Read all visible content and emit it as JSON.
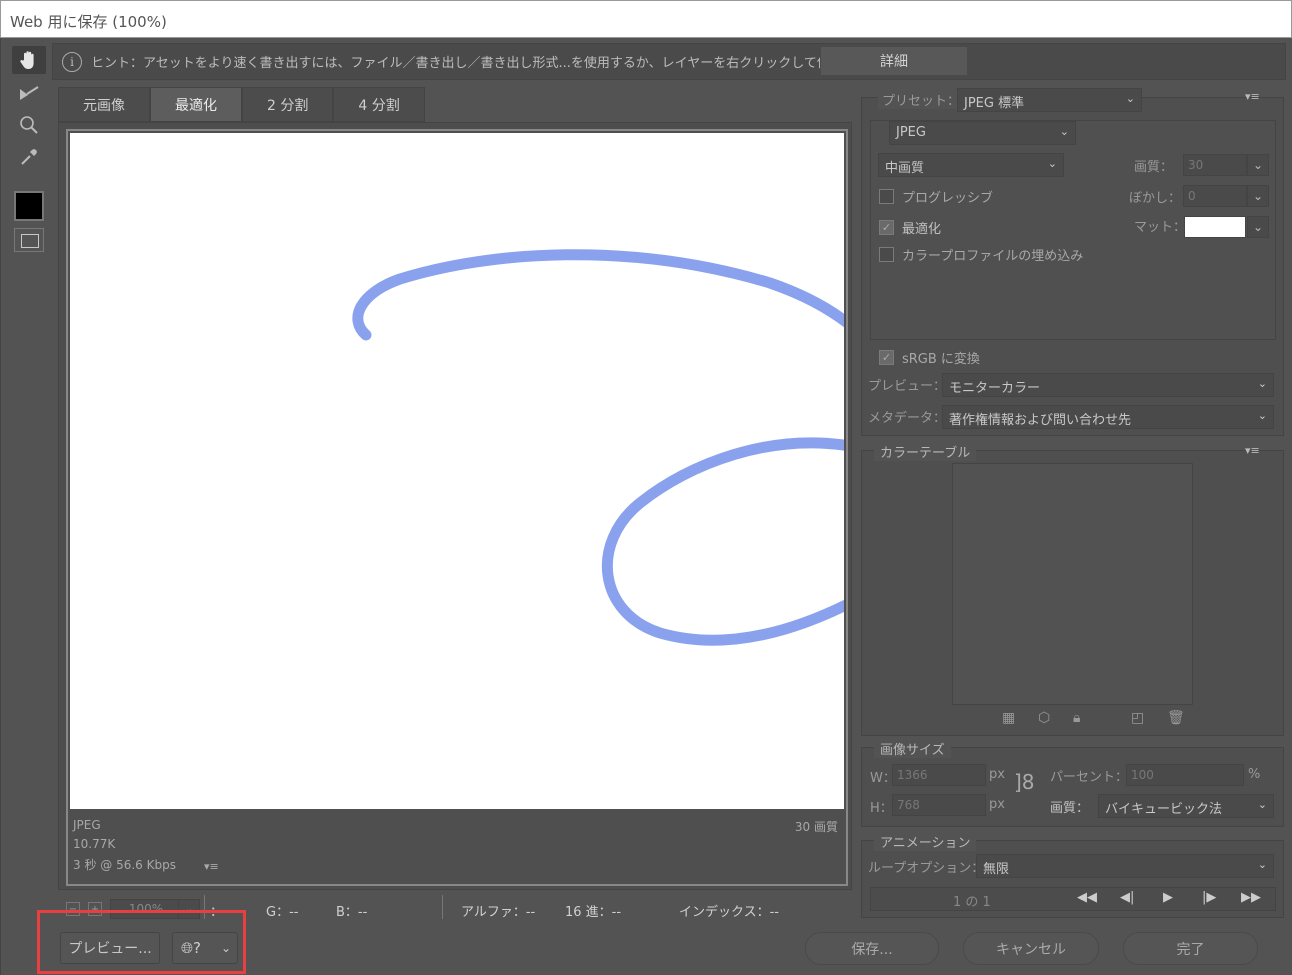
{
  "window": {
    "title": "Web 用に保存 (100%)"
  },
  "tools": [
    {
      "name": "hand-tool-icon",
      "glyph": "✋"
    },
    {
      "name": "slice-select-tool-icon",
      "glyph": "➶"
    },
    {
      "name": "zoom-tool-icon",
      "glyph": "⌕"
    },
    {
      "name": "eyedropper-tool-icon",
      "glyph": "✎"
    }
  ],
  "hint": {
    "text": "ヒント：アセットをより速く書き出すには、ファイル／書き出し／書き出し形式...を使用するか、レイヤーを右クリックして使用。",
    "details_button": "詳細"
  },
  "tabs": [
    "元画像",
    "最適化",
    "2 分割",
    "4 分割"
  ],
  "active_tab": "最適化",
  "preview_info": {
    "format": "JPEG",
    "size": "10.77K",
    "time": "3 秒 @ 56.6 Kbps",
    "quality": "30 画質",
    "menu_icon": "menu-icon"
  },
  "statusbar": {
    "zoom": "100%",
    "r": "：--",
    "g": "G：--",
    "b": "B：--",
    "alpha": "アルファ：--",
    "hex": "16 進：--",
    "index": "インデックス：--"
  },
  "bottom": {
    "preview_button": "プレビュー...",
    "save_button": "保存...",
    "cancel_button": "キャンセル",
    "done_button": "完了"
  },
  "settings": {
    "preset_label": "プリセット：",
    "preset_value": "JPEG 標準",
    "format_value": "JPEG",
    "quality_preset": "中画質",
    "quality_label": "画質：",
    "quality_value": "30",
    "progressive_label": "プログレッシブ",
    "progressive_checked": false,
    "blur_label": "ぼかし：",
    "blur_value": "0",
    "optimized_label": "最適化",
    "optimized_checked": true,
    "matte_label": "マット：",
    "matte_color": "#ffffff",
    "embed_profile_label": "カラープロファイルの埋め込み",
    "embed_profile_checked": false,
    "srgb_label": "sRGB に変換",
    "srgb_checked": true,
    "preview_label": "プレビュー：",
    "preview_value": "モニターカラー",
    "metadata_label": "メタデータ：",
    "metadata_value": "著作権情報および問い合わせ先"
  },
  "color_table": {
    "title": "カラーテーブル"
  },
  "image_size": {
    "title": "画像サイズ",
    "w_label": "W：",
    "w_value": "1366",
    "h_label": "H：",
    "h_value": "768",
    "px": "px",
    "percent_label": "パーセント：",
    "percent_value": "100",
    "percent_unit": "%",
    "quality_label": "画質：",
    "quality_value": "バイキュービック法"
  },
  "animation": {
    "title": "アニメーション",
    "loop_label": "ループオプション：",
    "loop_value": "無限",
    "frame_text": "1 の 1"
  },
  "colors": {
    "stroke": "#8aa2ee",
    "highlight": "#e84040"
  }
}
